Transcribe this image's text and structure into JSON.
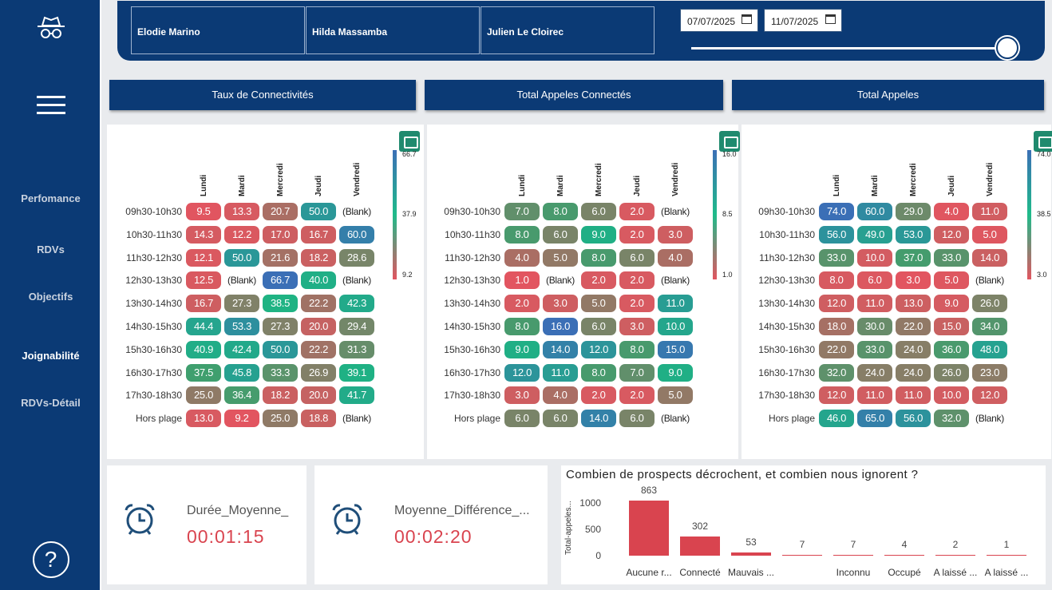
{
  "sidebar": {
    "items": [
      {
        "label": "Perfomance"
      },
      {
        "label": "RDVs"
      },
      {
        "label": "Objectifs"
      },
      {
        "label": "Joignabilité"
      },
      {
        "label": "RDVs-Détail"
      }
    ],
    "help": "?"
  },
  "filters": {
    "agents": [
      "Elodie Marino",
      "Hilda Massamba",
      "Julien Le Cloirec"
    ],
    "date_start": "07/07/2025",
    "date_end": "11/07/2025"
  },
  "sections": [
    "Taux de Connectivités",
    "Total Appeles Connectés",
    "Total Appeles"
  ],
  "days": [
    "Lundi",
    "Mardi",
    "Mercredi",
    "Jeudi",
    "Vendredi"
  ],
  "slots": [
    "09h30-10h30",
    "10h30-11h30",
    "11h30-12h30",
    "12h30-13h30",
    "13h30-14h30",
    "14h30-15h30",
    "15h30-16h30",
    "16h30-17h30",
    "17h30-18h30",
    "Hors plage"
  ],
  "heatmaps": [
    {
      "legend": [
        "66.7",
        "37.9",
        "9.2"
      ],
      "colors": [
        "#3b6fb6",
        "#1fbb8a",
        "#e25560"
      ],
      "rows": [
        [
          "9.5",
          "13.3",
          "20.7",
          "50.0",
          "(Blank)"
        ],
        [
          "14.3",
          "12.2",
          "17.0",
          "16.7",
          "60.0"
        ],
        [
          "12.1",
          "50.0",
          "21.6",
          "18.2",
          "28.6"
        ],
        [
          "12.5",
          "(Blank)",
          "66.7",
          "40.0",
          "(Blank)"
        ],
        [
          "16.7",
          "27.3",
          "38.5",
          "22.2",
          "42.3"
        ],
        [
          "44.4",
          "53.3",
          "27.3",
          "20.0",
          "29.4"
        ],
        [
          "40.9",
          "42.4",
          "50.0",
          "22.2",
          "31.3"
        ],
        [
          "37.5",
          "45.8",
          "33.3",
          "26.9",
          "39.1"
        ],
        [
          "25.0",
          "36.4",
          "18.2",
          "20.0",
          "41.7"
        ],
        [
          "13.0",
          "9.2",
          "25.0",
          "18.8",
          "(Blank)"
        ]
      ]
    },
    {
      "legend": [
        "16.0",
        "8.5",
        "1.0"
      ],
      "colors": [
        "#3b6fb6",
        "#1fbb8a",
        "#e25560"
      ],
      "rows": [
        [
          "7.0",
          "8.0",
          "6.0",
          "2.0",
          "(Blank)"
        ],
        [
          "8.0",
          "6.0",
          "9.0",
          "2.0",
          "3.0"
        ],
        [
          "4.0",
          "5.0",
          "8.0",
          "6.0",
          "4.0"
        ],
        [
          "1.0",
          "(Blank)",
          "2.0",
          "2.0",
          "(Blank)"
        ],
        [
          "2.0",
          "3.0",
          "5.0",
          "2.0",
          "11.0"
        ],
        [
          "8.0",
          "16.0",
          "6.0",
          "3.0",
          "10.0"
        ],
        [
          "9.0",
          "14.0",
          "12.0",
          "8.0",
          "15.0"
        ],
        [
          "12.0",
          "11.0",
          "8.0",
          "7.0",
          "9.0"
        ],
        [
          "3.0",
          "4.0",
          "2.0",
          "2.0",
          "5.0"
        ],
        [
          "6.0",
          "6.0",
          "14.0",
          "6.0",
          "(Blank)"
        ]
      ]
    },
    {
      "legend": [
        "74.0",
        "38.5",
        "3.0"
      ],
      "colors": [
        "#3b6fb6",
        "#1fbb8a",
        "#e25560"
      ],
      "rows": [
        [
          "74.0",
          "60.0",
          "29.0",
          "4.0",
          "11.0"
        ],
        [
          "56.0",
          "49.0",
          "53.0",
          "12.0",
          "5.0"
        ],
        [
          "33.0",
          "10.0",
          "37.0",
          "33.0",
          "14.0"
        ],
        [
          "8.0",
          "6.0",
          "3.0",
          "5.0",
          "(Blank)"
        ],
        [
          "12.0",
          "11.0",
          "13.0",
          "9.0",
          "26.0"
        ],
        [
          "18.0",
          "30.0",
          "22.0",
          "15.0",
          "34.0"
        ],
        [
          "22.0",
          "33.0",
          "24.0",
          "36.0",
          "48.0"
        ],
        [
          "32.0",
          "24.0",
          "24.0",
          "26.0",
          "23.0"
        ],
        [
          "12.0",
          "11.0",
          "11.0",
          "10.0",
          "12.0"
        ],
        [
          "46.0",
          "65.0",
          "56.0",
          "32.0",
          "(Blank)"
        ]
      ]
    }
  ],
  "kpis": [
    {
      "label": "Durée_Moyenne_",
      "value": "00:01:15"
    },
    {
      "label": "Moyenne_Différence_...",
      "value": "00:02:20"
    }
  ],
  "chart_data": {
    "type": "bar",
    "title": "Combien de prospects décrochent, et combien nous ignorent ?",
    "ylabel": "Total-appeles...",
    "categories": [
      "Aucune r...",
      "Connecté",
      "Mauvais ...",
      "",
      "Inconnu",
      "Occupé",
      "A laissé ...",
      "A laissé ..."
    ],
    "values": [
      863,
      302,
      53,
      7,
      7,
      4,
      2,
      1
    ],
    "yticks": [
      "1000",
      "500",
      "0"
    ],
    "ylim": [
      0,
      1000
    ],
    "color": "#d9444f"
  }
}
